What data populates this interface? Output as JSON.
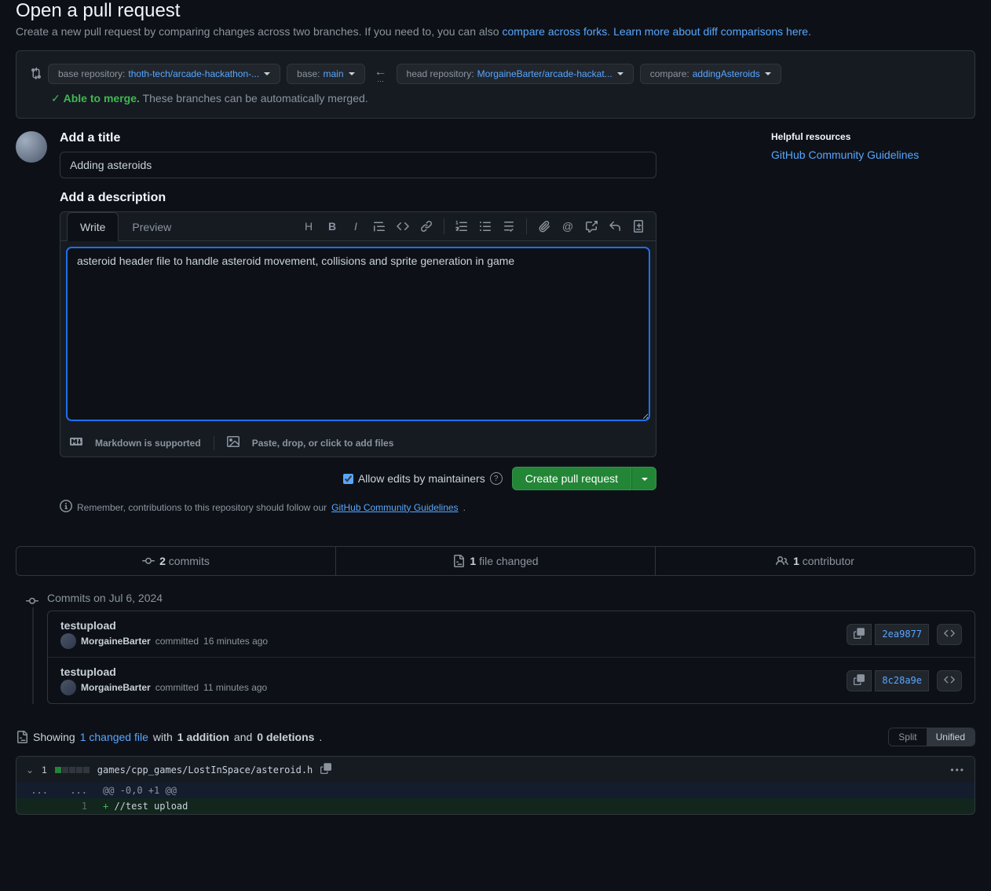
{
  "header": {
    "title": "Open a pull request",
    "subtitle_prefix": "Create a new pull request by comparing changes across two branches. If you need to, you can also ",
    "compare_forks_link": "compare across forks",
    "subtitle_sep": ". ",
    "learn_more_link": "Learn more about diff comparisons here."
  },
  "compare": {
    "base_repo_label": "base repository: ",
    "base_repo_value": "thoth-tech/arcade-hackathon-...",
    "base_branch_label": "base: ",
    "base_branch_value": "main",
    "head_repo_label": "head repository: ",
    "head_repo_value": "MorgaineBarter/arcade-hackat...",
    "compare_label": "compare: ",
    "compare_value": "addingAsteroids",
    "merge_able": "Able to merge.",
    "merge_msg": " These branches can be automatically merged."
  },
  "form": {
    "title_label": "Add a title",
    "title_value": "Adding asteroids",
    "desc_label": "Add a description",
    "write_tab": "Write",
    "preview_tab": "Preview",
    "desc_value": "asteroid header file to handle asteroid movement, collisions and sprite generation in game",
    "markdown_note": "Markdown is supported",
    "attach_note": "Paste, drop, or click to add files",
    "allow_edits": "Allow edits by maintainers",
    "create_btn": "Create pull request"
  },
  "contrib_note": {
    "prefix": "Remember, contributions to this repository should follow our ",
    "link": "GitHub Community Guidelines"
  },
  "sidebar": {
    "resources_title": "Helpful resources",
    "guidelines_link": "GitHub Community Guidelines"
  },
  "stats": {
    "commits_count": "2",
    "commits_label": " commits",
    "files_count": "1",
    "files_label": " file changed",
    "contributors_count": "1",
    "contributors_label": " contributor"
  },
  "commits": {
    "date_label": "Commits on Jul 6, 2024",
    "items": [
      {
        "title": "testupload",
        "author": "MorgaineBarter",
        "action": " committed ",
        "time": "16 minutes ago",
        "sha": "2ea9877"
      },
      {
        "title": "testupload",
        "author": "MorgaineBarter",
        "action": " committed ",
        "time": "11 minutes ago",
        "sha": "8c28a9e"
      }
    ]
  },
  "diff": {
    "showing": "Showing ",
    "changed_files": "1 changed file",
    "with": " with ",
    "additions": "1 addition",
    "and": " and ",
    "deletions": "0 deletions",
    "split": "Split",
    "unified": "Unified",
    "file_count": "1",
    "file_path": "games/cpp_games/LostInSpace/asteroid.h",
    "hunk": "@@ -0,0 +1 @@",
    "add_line_num": "1",
    "add_line": "//test upload",
    "expand": "...",
    "expand2": "..."
  }
}
